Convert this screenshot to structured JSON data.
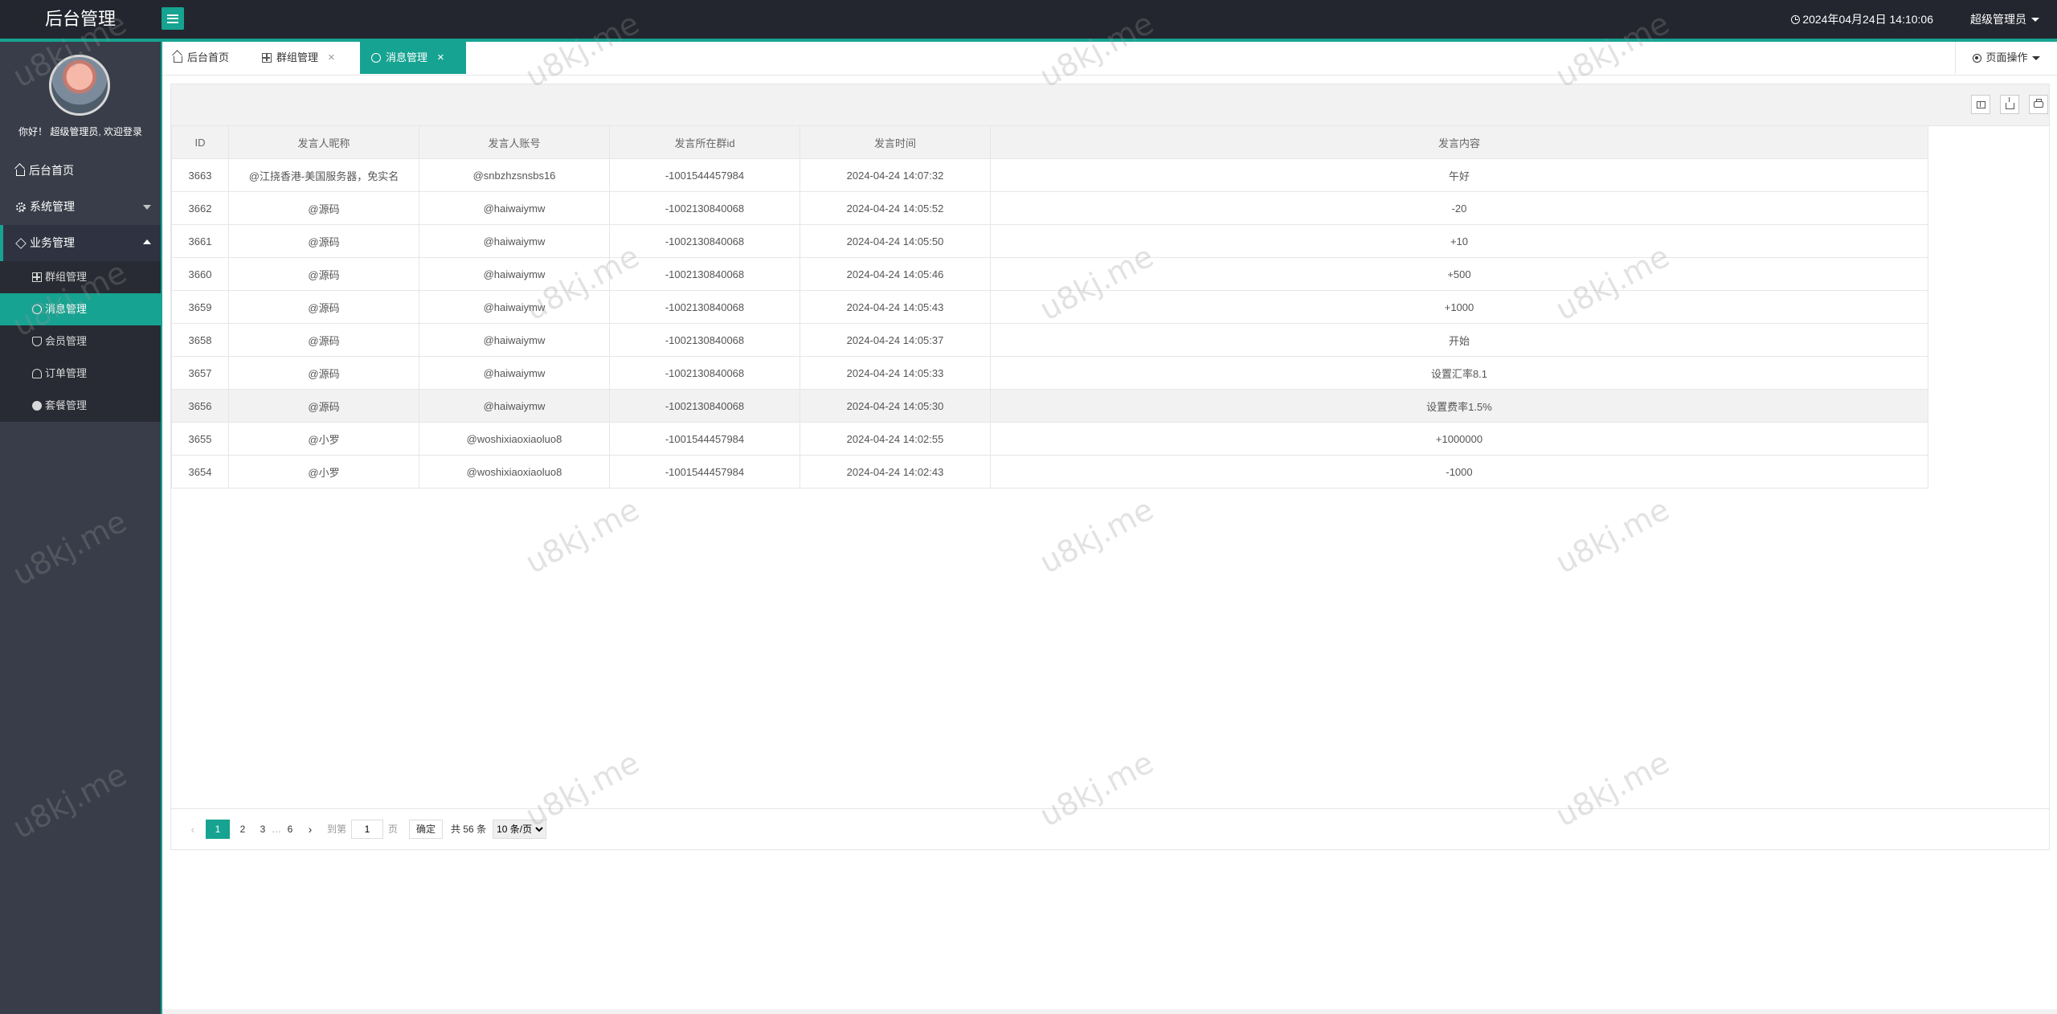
{
  "app": {
    "title": "后台管理"
  },
  "header": {
    "datetime": "2024年04月24日 14:10:06",
    "user": "超级管理员"
  },
  "sidebar": {
    "welcome": "你好！ 超级管理员, 欢迎登录",
    "home": "后台首页",
    "system": "系统管理",
    "business": "业务管理",
    "sub": [
      {
        "label": "群组管理",
        "icon": "grid-icon"
      },
      {
        "label": "消息管理",
        "icon": "chat-icon"
      },
      {
        "label": "会员管理",
        "icon": "shield-icon"
      },
      {
        "label": "订单管理",
        "icon": "gauge-icon"
      },
      {
        "label": "套餐管理",
        "icon": "compass-icon"
      }
    ]
  },
  "tabs": [
    {
      "label": "后台首页"
    },
    {
      "label": "群组管理"
    },
    {
      "label": "消息管理"
    }
  ],
  "page_ops": "页面操作",
  "table": {
    "headers": [
      "ID",
      "发言人昵称",
      "发言人账号",
      "发言所在群id",
      "发言时间",
      "发言内容"
    ],
    "rows": [
      [
        "3663",
        "@江挠香港-美国服务器，免实名",
        "@snbzhzsnsbs16",
        "-1001544457984",
        "2024-04-24 14:07:32",
        "午好"
      ],
      [
        "3662",
        "@源码",
        "@haiwaiymw",
        "-1002130840068",
        "2024-04-24 14:05:52",
        "-20"
      ],
      [
        "3661",
        "@源码",
        "@haiwaiymw",
        "-1002130840068",
        "2024-04-24 14:05:50",
        "+10"
      ],
      [
        "3660",
        "@源码",
        "@haiwaiymw",
        "-1002130840068",
        "2024-04-24 14:05:46",
        "+500"
      ],
      [
        "3659",
        "@源码",
        "@haiwaiymw",
        "-1002130840068",
        "2024-04-24 14:05:43",
        "+1000"
      ],
      [
        "3658",
        "@源码",
        "@haiwaiymw",
        "-1002130840068",
        "2024-04-24 14:05:37",
        "开始"
      ],
      [
        "3657",
        "@源码",
        "@haiwaiymw",
        "-1002130840068",
        "2024-04-24 14:05:33",
        "设置汇率8.1"
      ],
      [
        "3656",
        "@源码",
        "@haiwaiymw",
        "-1002130840068",
        "2024-04-24 14:05:30",
        "设置费率1.5%"
      ],
      [
        "3655",
        "@小罗",
        "@woshixiaoxiaoluo8",
        "-1001544457984",
        "2024-04-24 14:02:55",
        "+1000000"
      ],
      [
        "3654",
        "@小罗",
        "@woshixiaoxiaoluo8",
        "-1001544457984",
        "2024-04-24 14:02:43",
        "-1000"
      ]
    ]
  },
  "pager": {
    "pages": [
      "1",
      "2",
      "3",
      "…",
      "6"
    ],
    "goto_label": "到第",
    "page_value": "1",
    "page_unit": "页",
    "confirm": "确定",
    "total": "共 56 条",
    "page_size": "10 条/页"
  },
  "watermark": "u8kj.me",
  "colors": {
    "accent": "#16a391",
    "sidebar": "#393d49",
    "header": "#23262e"
  }
}
